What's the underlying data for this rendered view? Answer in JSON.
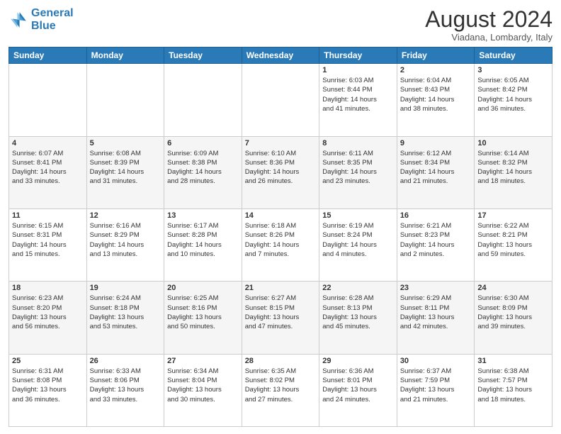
{
  "header": {
    "logo_line1": "General",
    "logo_line2": "Blue",
    "month": "August 2024",
    "location": "Viadana, Lombardy, Italy"
  },
  "weekdays": [
    "Sunday",
    "Monday",
    "Tuesday",
    "Wednesday",
    "Thursday",
    "Friday",
    "Saturday"
  ],
  "weeks": [
    [
      {
        "day": "",
        "info": ""
      },
      {
        "day": "",
        "info": ""
      },
      {
        "day": "",
        "info": ""
      },
      {
        "day": "",
        "info": ""
      },
      {
        "day": "1",
        "info": "Sunrise: 6:03 AM\nSunset: 8:44 PM\nDaylight: 14 hours\nand 41 minutes."
      },
      {
        "day": "2",
        "info": "Sunrise: 6:04 AM\nSunset: 8:43 PM\nDaylight: 14 hours\nand 38 minutes."
      },
      {
        "day": "3",
        "info": "Sunrise: 6:05 AM\nSunset: 8:42 PM\nDaylight: 14 hours\nand 36 minutes."
      }
    ],
    [
      {
        "day": "4",
        "info": "Sunrise: 6:07 AM\nSunset: 8:41 PM\nDaylight: 14 hours\nand 33 minutes."
      },
      {
        "day": "5",
        "info": "Sunrise: 6:08 AM\nSunset: 8:39 PM\nDaylight: 14 hours\nand 31 minutes."
      },
      {
        "day": "6",
        "info": "Sunrise: 6:09 AM\nSunset: 8:38 PM\nDaylight: 14 hours\nand 28 minutes."
      },
      {
        "day": "7",
        "info": "Sunrise: 6:10 AM\nSunset: 8:36 PM\nDaylight: 14 hours\nand 26 minutes."
      },
      {
        "day": "8",
        "info": "Sunrise: 6:11 AM\nSunset: 8:35 PM\nDaylight: 14 hours\nand 23 minutes."
      },
      {
        "day": "9",
        "info": "Sunrise: 6:12 AM\nSunset: 8:34 PM\nDaylight: 14 hours\nand 21 minutes."
      },
      {
        "day": "10",
        "info": "Sunrise: 6:14 AM\nSunset: 8:32 PM\nDaylight: 14 hours\nand 18 minutes."
      }
    ],
    [
      {
        "day": "11",
        "info": "Sunrise: 6:15 AM\nSunset: 8:31 PM\nDaylight: 14 hours\nand 15 minutes."
      },
      {
        "day": "12",
        "info": "Sunrise: 6:16 AM\nSunset: 8:29 PM\nDaylight: 14 hours\nand 13 minutes."
      },
      {
        "day": "13",
        "info": "Sunrise: 6:17 AM\nSunset: 8:28 PM\nDaylight: 14 hours\nand 10 minutes."
      },
      {
        "day": "14",
        "info": "Sunrise: 6:18 AM\nSunset: 8:26 PM\nDaylight: 14 hours\nand 7 minutes."
      },
      {
        "day": "15",
        "info": "Sunrise: 6:19 AM\nSunset: 8:24 PM\nDaylight: 14 hours\nand 4 minutes."
      },
      {
        "day": "16",
        "info": "Sunrise: 6:21 AM\nSunset: 8:23 PM\nDaylight: 14 hours\nand 2 minutes."
      },
      {
        "day": "17",
        "info": "Sunrise: 6:22 AM\nSunset: 8:21 PM\nDaylight: 13 hours\nand 59 minutes."
      }
    ],
    [
      {
        "day": "18",
        "info": "Sunrise: 6:23 AM\nSunset: 8:20 PM\nDaylight: 13 hours\nand 56 minutes."
      },
      {
        "day": "19",
        "info": "Sunrise: 6:24 AM\nSunset: 8:18 PM\nDaylight: 13 hours\nand 53 minutes."
      },
      {
        "day": "20",
        "info": "Sunrise: 6:25 AM\nSunset: 8:16 PM\nDaylight: 13 hours\nand 50 minutes."
      },
      {
        "day": "21",
        "info": "Sunrise: 6:27 AM\nSunset: 8:15 PM\nDaylight: 13 hours\nand 47 minutes."
      },
      {
        "day": "22",
        "info": "Sunrise: 6:28 AM\nSunset: 8:13 PM\nDaylight: 13 hours\nand 45 minutes."
      },
      {
        "day": "23",
        "info": "Sunrise: 6:29 AM\nSunset: 8:11 PM\nDaylight: 13 hours\nand 42 minutes."
      },
      {
        "day": "24",
        "info": "Sunrise: 6:30 AM\nSunset: 8:09 PM\nDaylight: 13 hours\nand 39 minutes."
      }
    ],
    [
      {
        "day": "25",
        "info": "Sunrise: 6:31 AM\nSunset: 8:08 PM\nDaylight: 13 hours\nand 36 minutes."
      },
      {
        "day": "26",
        "info": "Sunrise: 6:33 AM\nSunset: 8:06 PM\nDaylight: 13 hours\nand 33 minutes."
      },
      {
        "day": "27",
        "info": "Sunrise: 6:34 AM\nSunset: 8:04 PM\nDaylight: 13 hours\nand 30 minutes."
      },
      {
        "day": "28",
        "info": "Sunrise: 6:35 AM\nSunset: 8:02 PM\nDaylight: 13 hours\nand 27 minutes."
      },
      {
        "day": "29",
        "info": "Sunrise: 6:36 AM\nSunset: 8:01 PM\nDaylight: 13 hours\nand 24 minutes."
      },
      {
        "day": "30",
        "info": "Sunrise: 6:37 AM\nSunset: 7:59 PM\nDaylight: 13 hours\nand 21 minutes."
      },
      {
        "day": "31",
        "info": "Sunrise: 6:38 AM\nSunset: 7:57 PM\nDaylight: 13 hours\nand 18 minutes."
      }
    ]
  ]
}
